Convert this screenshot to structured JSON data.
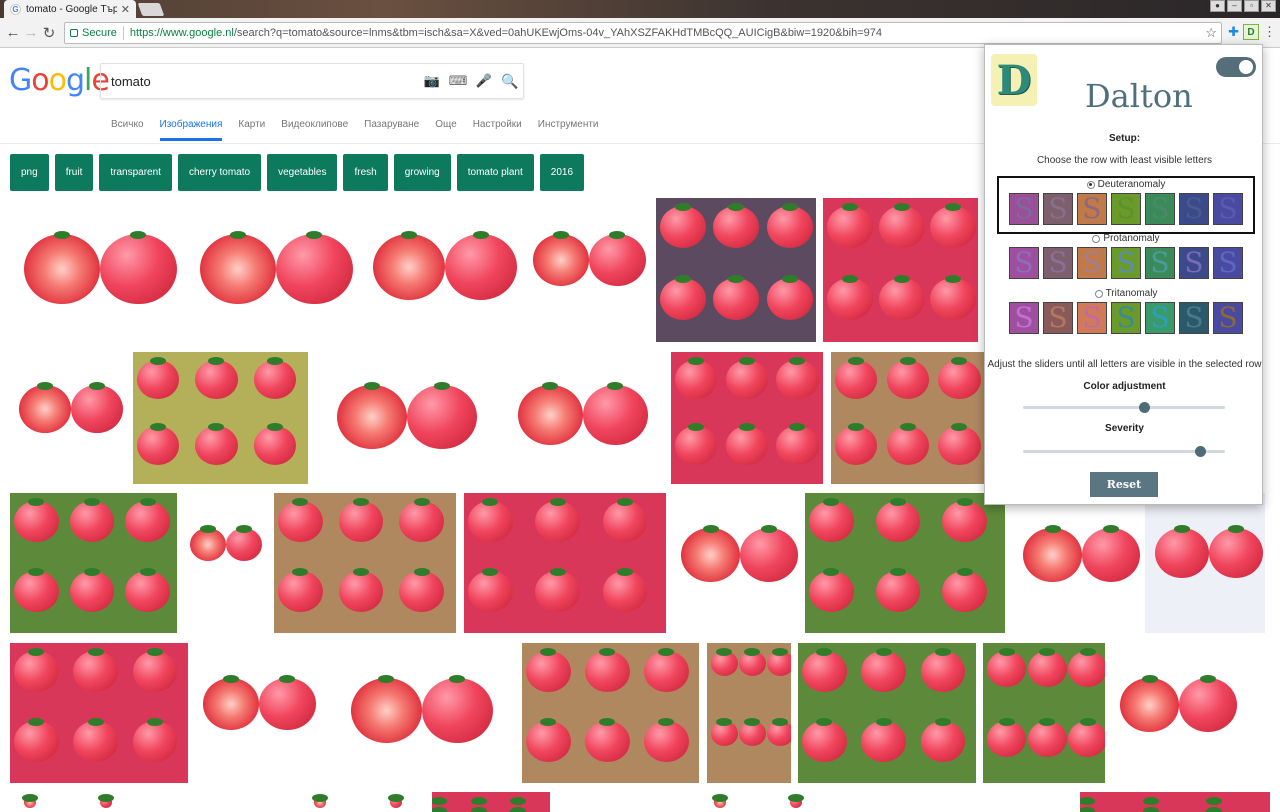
{
  "browser": {
    "tab_title": "tomato - Google Търсен",
    "favicon": "G",
    "secure_label": "Secure",
    "url_host": "https://www.google.nl",
    "url_rest": "/search?q=tomato&source=lnms&tbm=isch&sa=X&ved=0ahUKEwjOms-04v_YAhXSZFAKHdTMBcQQ_AUICigB&biw=1920&bih=974",
    "ext_letter": "D"
  },
  "google": {
    "search_value": "tomato",
    "nav_tabs": [
      "Всичко",
      "Изображения",
      "Карти",
      "Видеоклипове",
      "Пазаруване",
      "Още",
      "Настройки",
      "Инструменти"
    ],
    "active_tab": "Изображения",
    "chips": [
      "png",
      "fruit",
      "transparent",
      "cherry tomato",
      "vegetables",
      "fresh",
      "growing",
      "tomato plant",
      "2016"
    ],
    "chip_color": "#0d7a5d"
  },
  "dalton": {
    "logo_letter": "D",
    "title": "Dalton",
    "enabled": true,
    "setup_label": "Setup:",
    "instruction": "Choose the row with least visible letters",
    "options": [
      {
        "label": "Deuteranomaly",
        "selected": true,
        "swatches": [
          [
            "#9b4f98",
            "#7b6aa0"
          ],
          [
            "#7d5f6e",
            "#8a6f88"
          ],
          [
            "#c07a4a",
            "#8a6a7a"
          ],
          [
            "#6a9a2a",
            "#58932e"
          ],
          [
            "#3a8a5a",
            "#4a8a6a"
          ],
          [
            "#3a4a8a",
            "#4a5a8a"
          ],
          [
            "#4a4aa0",
            "#5a5ab0"
          ]
        ]
      },
      {
        "label": "Protanomaly",
        "selected": false,
        "swatches": [
          [
            "#a04fa0",
            "#8a70b8"
          ],
          [
            "#7d5f6e",
            "#8a7098"
          ],
          [
            "#c07a4a",
            "#a08090"
          ],
          [
            "#6a9a2a",
            "#5a8cba"
          ],
          [
            "#3a8a5a",
            "#4a9aa0"
          ],
          [
            "#3a4a8a",
            "#7a6aba"
          ],
          [
            "#4a4aa0",
            "#5a6ac0"
          ]
        ]
      },
      {
        "label": "Tritanomaly",
        "selected": false,
        "swatches": [
          [
            "#a04fa0",
            "#c070d0"
          ],
          [
            "#8a5a5a",
            "#b07a60"
          ],
          [
            "#d07a5a",
            "#c06aa0"
          ],
          [
            "#6a9a2a",
            "#3a8a9a"
          ],
          [
            "#3a9a6a",
            "#2aa0c0"
          ],
          [
            "#2a5a6a",
            "#4a7a8a"
          ],
          [
            "#4a4aa0",
            "#8a6a3a"
          ]
        ]
      }
    ],
    "adjust_instruction": "Adjust the sliders until all letters are visible in the selected row",
    "color_adjustment_label": "Color adjustment",
    "color_adjustment_value": 0.6,
    "severity_label": "Severity",
    "severity_value": 0.88,
    "reset_label": "Reset",
    "swatch_letter": "S"
  }
}
